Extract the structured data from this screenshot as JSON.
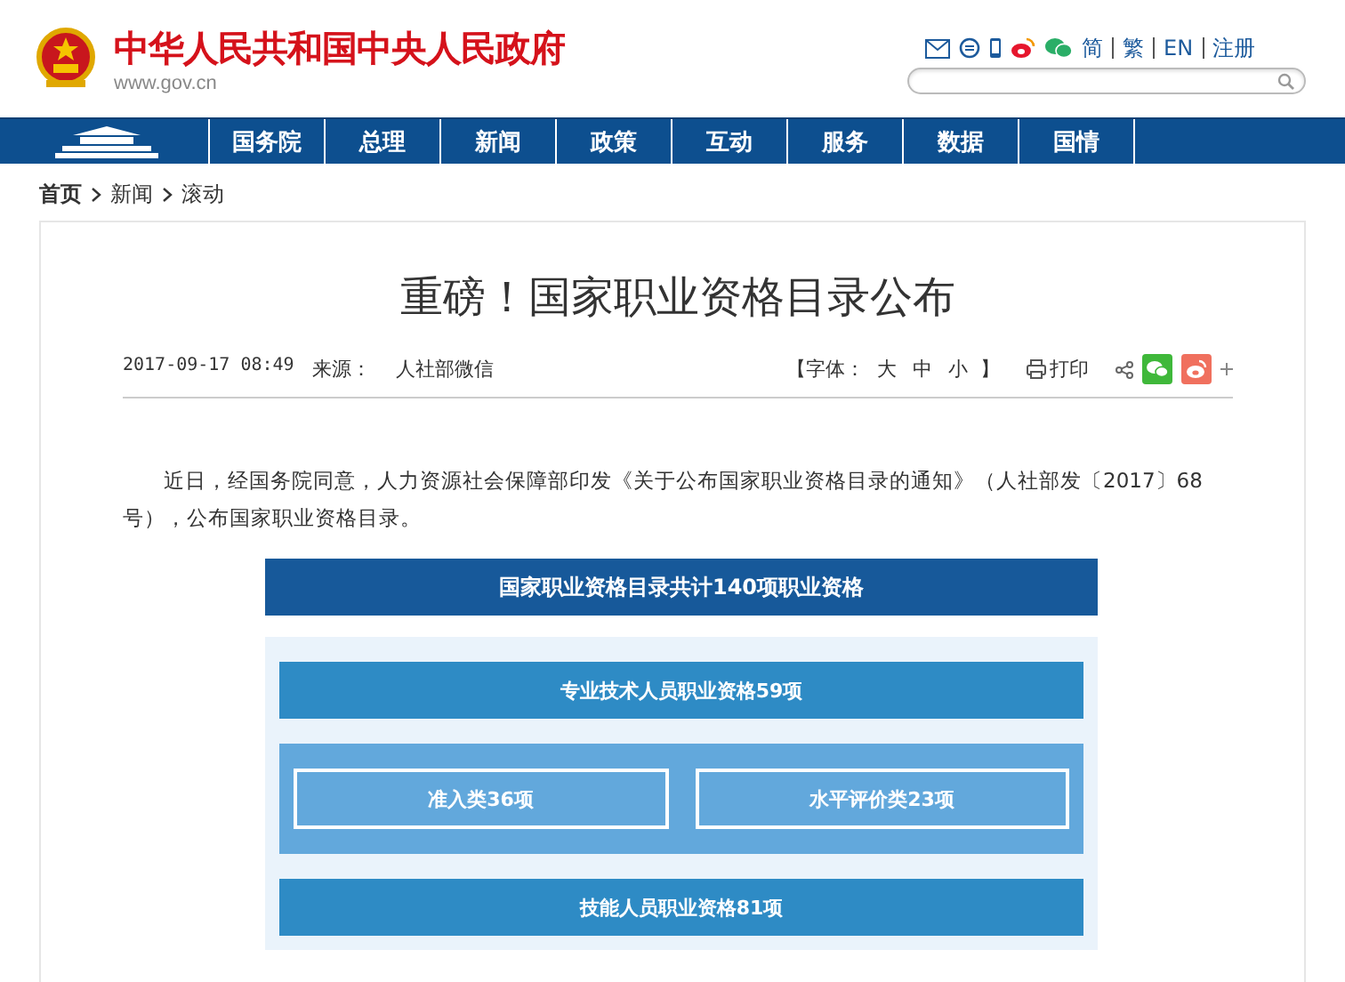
{
  "header": {
    "site_title": "中华人民共和国中央人民政府",
    "site_url": "www.gov.cn",
    "lang_links": [
      "简",
      "繁",
      "EN",
      "注册"
    ]
  },
  "nav": {
    "items": [
      {
        "label": "国务院"
      },
      {
        "label": "总理"
      },
      {
        "label": "新闻"
      },
      {
        "label": "政策"
      },
      {
        "label": "互动"
      },
      {
        "label": "服务"
      },
      {
        "label": "数据"
      },
      {
        "label": "国情"
      }
    ]
  },
  "breadcrumb": [
    "首页",
    "新闻",
    "滚动"
  ],
  "article": {
    "title": "重磅！国家职业资格目录公布",
    "date": "2017-09-17 08:49",
    "source_label": "来源：",
    "source": "人社部微信",
    "font_label": "【字体：",
    "font_sizes": [
      "大",
      "中",
      "小"
    ],
    "font_end": "】",
    "print": "打印",
    "paragraphs": [
      "近日，经国务院同意，人力资源社会保障部印发《关于公布国家职业资格目录的通知》（人社部发〔2017〕68号），公布国家职业资格目录。"
    ],
    "infographic": {
      "heading": "国家职业资格目录共计140项职业资格",
      "professional": "专业技术人员职业资格59项",
      "subcategories": [
        "准入类36项",
        "水平评价类23项"
      ],
      "skills": "技能人员职业资格81项"
    }
  }
}
